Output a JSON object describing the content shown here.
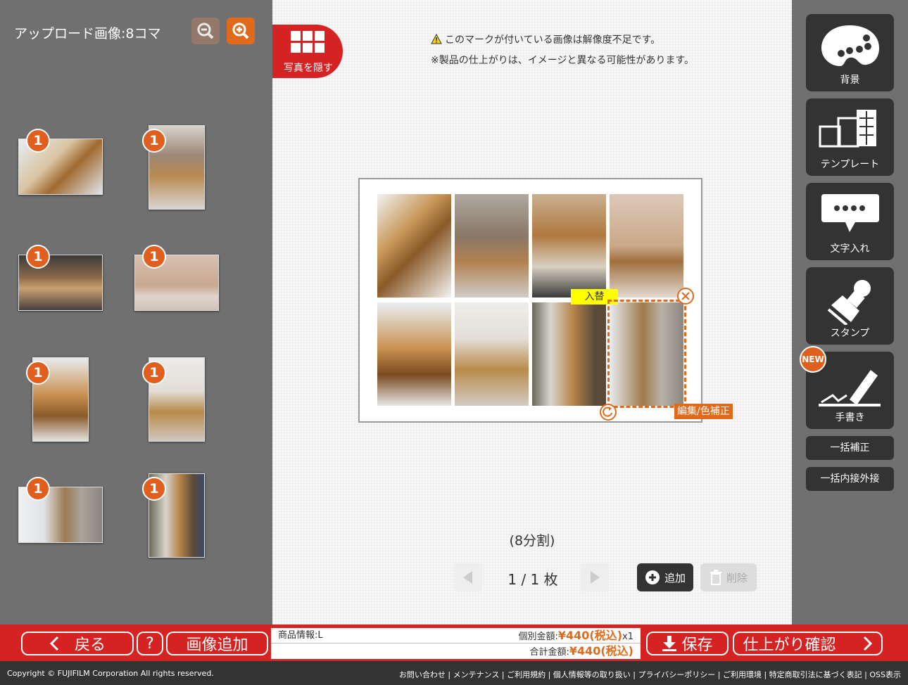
{
  "left_panel": {
    "title": "アップロード画像:8コマ",
    "zoom_out_icon": "zoom-out-icon",
    "zoom_in_icon": "zoom-in-icon"
  },
  "thumbnails": [
    {
      "count": "1"
    },
    {
      "count": "1"
    },
    {
      "count": "1"
    },
    {
      "count": "1"
    },
    {
      "count": "1"
    },
    {
      "count": "1"
    },
    {
      "count": "1"
    },
    {
      "count": "1"
    }
  ],
  "center": {
    "hide_photos_label": "写真を隠す",
    "notice1": "このマークが付いている画像は解像度不足です。",
    "notice2": "※製品の仕上がりは、イメージと異なる可能性があります。",
    "swap_label": "入替",
    "edit_label": "編集/色補正",
    "split_label": "(8分割)",
    "pager": "1 / 1 枚",
    "add_label": "追加",
    "delete_label": "削除"
  },
  "tools": {
    "background": "背景",
    "template": "テンプレート",
    "text": "文字入れ",
    "stamp": "スタンプ",
    "handwriting": "手書き",
    "new_badge": "NEW",
    "bulk_correct": "一括補正",
    "bulk_fit": "一括内接外接"
  },
  "bottom": {
    "back": "戻る",
    "help": "?",
    "add_image": "画像追加",
    "product_info": "商品情報:L",
    "unit_price_label": "個別金額:",
    "unit_price": "¥440(税込)",
    "quantity": "x1",
    "total_label": "合計金額:",
    "total_price": "¥440(税込)",
    "save": "保存",
    "confirm": "仕上がり確認"
  },
  "footer": {
    "copyright": "Copyright © FUJIFILM Corporation All rights reserved.",
    "links": "お問い合わせ | メンテナンス | ご利用規約 | 個人情報等の取り扱い | プライバシーポリシー | ご利用環境 | 特定商取引法に基づく表記 | OSS表示"
  },
  "colors": {
    "accent_red": "#d42322",
    "accent_orange": "#e06a1b",
    "panel_gray": "#707070"
  }
}
